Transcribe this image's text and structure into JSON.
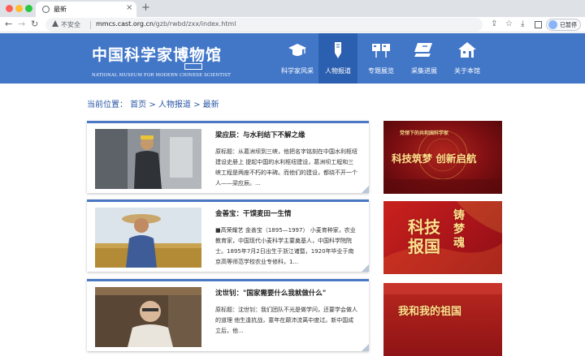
{
  "browser": {
    "tab_title": "最新",
    "tab_close": "×",
    "new_tab": "+",
    "security_label": "不安全",
    "url_host": "mmcs.cast.org.cn",
    "url_path": "/gzb/rwbd/zxx/index.html",
    "profile_label": "已暂停"
  },
  "site": {
    "logo_title": "中国科学家博物馆",
    "logo_subtitle": "NATIONAL MUSEUM FOR MODERN CHINESE SCIENTIST",
    "header_color": "#4277c8",
    "nav": [
      {
        "label": "科学家风采",
        "icon": "graduation-cap-icon"
      },
      {
        "label": "人物报道",
        "icon": "pen-icon",
        "active": true
      },
      {
        "label": "专题展览",
        "icon": "exhibition-boards-icon"
      },
      {
        "label": "采集进展",
        "icon": "computer-icon"
      },
      {
        "label": "关于本馆",
        "icon": "house-icon"
      }
    ]
  },
  "breadcrumb": "当前位置： 首页 > 人物报道 > 最新",
  "articles": [
    {
      "title": "梁应辰：与水利结下不解之缘",
      "summary": "原标题：从葛洲坝到三峡，他把名字铭刻在中国水利枢纽建设史册上 提起中国的水利枢纽建设，葛洲坝工程和三峡工程是两座不朽的丰碑。而他们的建设，都绕不开一个人——梁应辰。..."
    },
    {
      "title": "金善宝：干馍麦田一生情",
      "summary": "■高荣耀艺 金善宝（1895—1997） 小麦育种家，农业教育家，中国现代小麦科学主要奠基人，中国科学院院士。1895年7月2日出生于浙江诸暨，1920年毕业于南京高等师范学校农业专修科，1..."
    },
    {
      "title": "沈世钊：\"国家需要什么我就做什么\"",
      "summary": "原标题：沈世钊：我们团队不光是做学问，还要学会做人的道理 他生逢抗战，童年在颠沛流离中度过。新中国成立后，他..."
    }
  ],
  "banners": [
    {
      "top_line": "党领下的共和国科学家",
      "main_line": "科技筑梦 创新启航"
    },
    {
      "main_line": "科技报国",
      "side_line": "铸梦魂"
    },
    {
      "main_line": "我和我的祖国"
    }
  ]
}
